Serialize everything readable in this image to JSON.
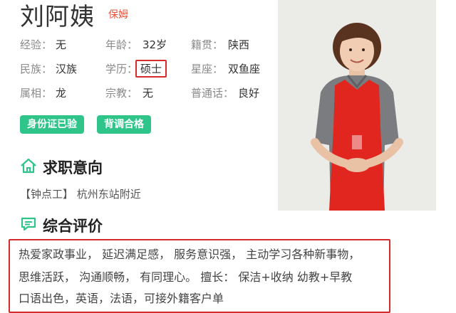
{
  "profile": {
    "name": "刘阿姨",
    "role": "保姆"
  },
  "info": [
    {
      "k": "经验：",
      "v": "无"
    },
    {
      "k": "年龄：",
      "v": "32岁"
    },
    {
      "k": "籍贯：",
      "v": "陕西"
    },
    {
      "k": "民族：",
      "v": "汉族"
    },
    {
      "k": "学历：",
      "v": "硕士"
    },
    {
      "k": "星座：",
      "v": "双鱼座"
    },
    {
      "k": "属相：",
      "v": "龙"
    },
    {
      "k": "宗教：",
      "v": "无"
    },
    {
      "k": "普通话：",
      "v": "良好"
    }
  ],
  "badges": [
    "身份证已验",
    "背调合格"
  ],
  "job_intent": {
    "title": "求职意向",
    "tag": "【钟点工】",
    "location": "杭州东站附近"
  },
  "evaluation": {
    "title": "综合评价",
    "lines": [
      "热爱家政事业， 延迟满足感， 服务意识强， 主动学习各种新事物，",
      "思维活跃， 沟通顺畅， 有同理心。 擅长： 保洁+收纳 幼教+早教",
      "口语出色，英语，法语，可接外籍客户单"
    ]
  },
  "colors": {
    "accent_green": "#2fc58a",
    "highlight_red": "#d42b2b",
    "role_orange": "#e8543c",
    "apron_red": "#e0261f",
    "shirt_grey": "#7a7c80"
  },
  "icons": [
    "home-icon",
    "comment-icon"
  ]
}
